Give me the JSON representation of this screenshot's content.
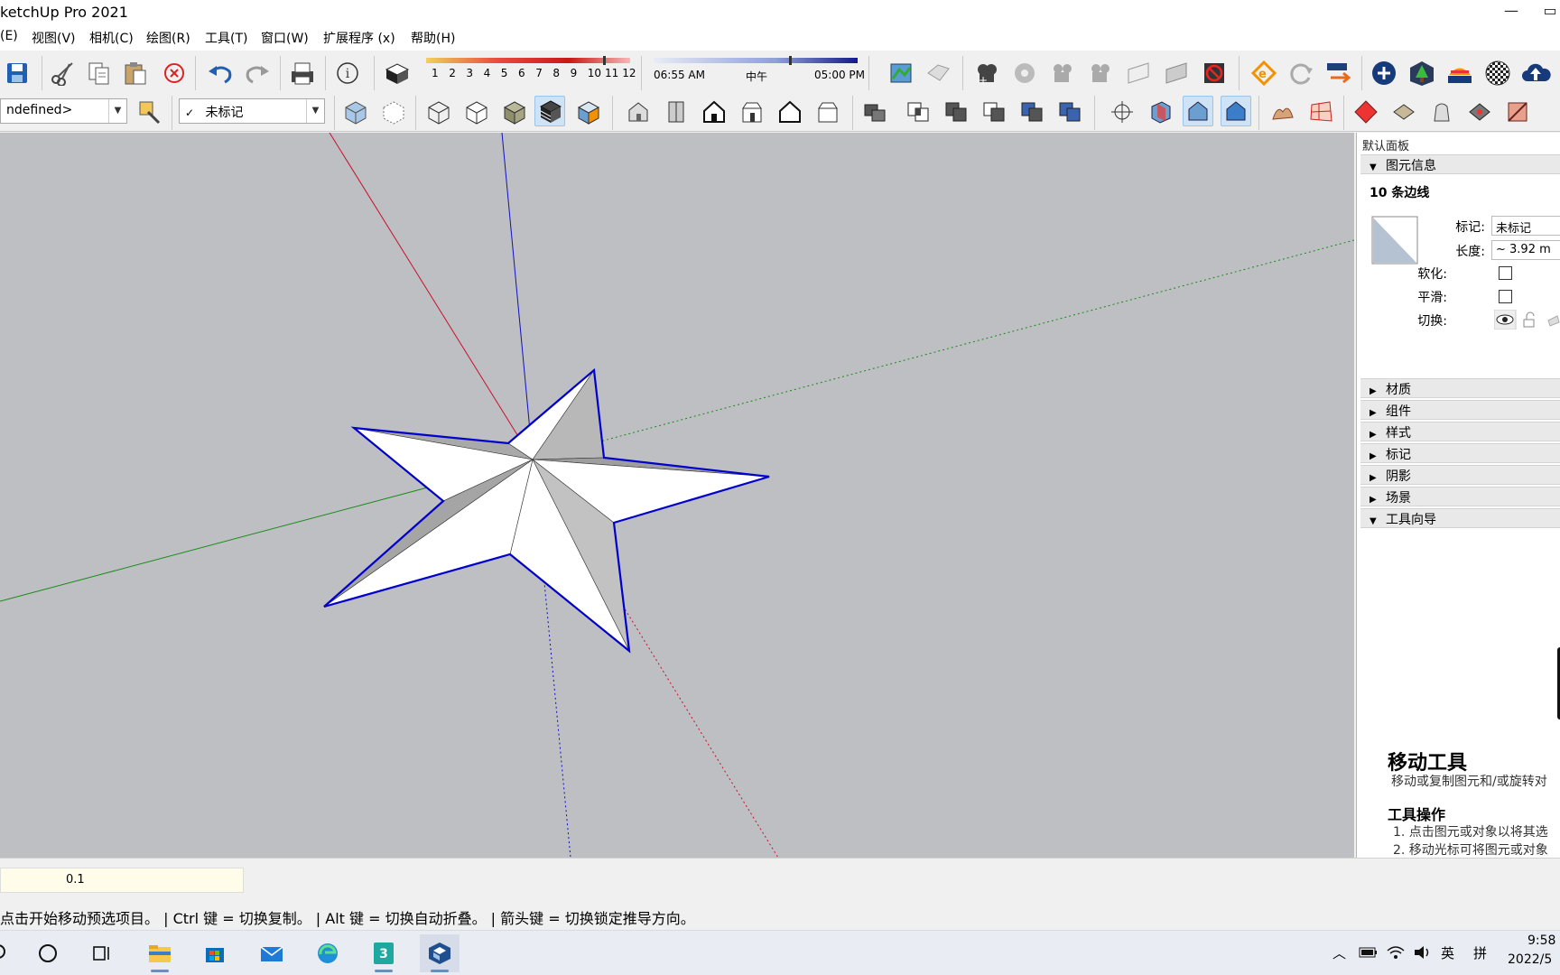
{
  "window": {
    "title": "ketchUp Pro 2021",
    "min_glyph": "—",
    "max_glyph": "▭"
  },
  "menubar": {
    "items": [
      "(E)",
      "视图(V)",
      "相机(C)",
      "绘图(R)",
      "工具(T)",
      "窗口(W)",
      "扩展程序 (x)",
      "帮助(H)"
    ]
  },
  "shadow": {
    "month_ticks": [
      "1",
      "2",
      "3",
      "4",
      "5",
      "6",
      "7",
      "8",
      "9",
      "10",
      "11",
      "12"
    ],
    "time_start": "06:55 AM",
    "time_mid": "中午",
    "time_end": "05:00 PM"
  },
  "toolbar2": {
    "style_dropdown": "ndefined>",
    "tag_dropdown_check": "✓",
    "tag_dropdown": "未标记"
  },
  "panel": {
    "title": "默认面板",
    "entity_info": {
      "header": "图元信息",
      "summary": "10 条边线",
      "tag_label": "标记:",
      "tag_value": "未标记",
      "length_label": "长度:",
      "length_value": "~ 3.92 m",
      "soften_label": "软化:",
      "smooth_label": "平滑:",
      "toggle_label": "切换:"
    },
    "sections": [
      "材质",
      "组件",
      "样式",
      "标记",
      "阴影",
      "场景"
    ],
    "instructor": {
      "header": "工具向导",
      "tool_title": "移动工具",
      "tool_desc": "移动或复制图元和/或旋转对",
      "ops_title": "工具操作",
      "op1": "1. 点击图元或对象以将其选",
      "op2": "2. 移动光标可将图元或对象"
    }
  },
  "measurements": {
    "value": "0.1"
  },
  "status": {
    "text": "点击开始移动预选项目。 | Ctrl 键 = 切换复制。 | Alt 键 = 切换自动折叠。 | 箭头键 = 切换锁定推导方向。"
  },
  "taskbar": {
    "ime_lang": "英",
    "ime_mode": "拼",
    "time": "9:58",
    "date": "2022/5"
  },
  "colors": {
    "viewport_bg": "#bebfc3",
    "red_axis": "#c8102e",
    "green_axis": "#1a8a1a",
    "blue_axis": "#1010c0",
    "selection": "#0000cc"
  }
}
